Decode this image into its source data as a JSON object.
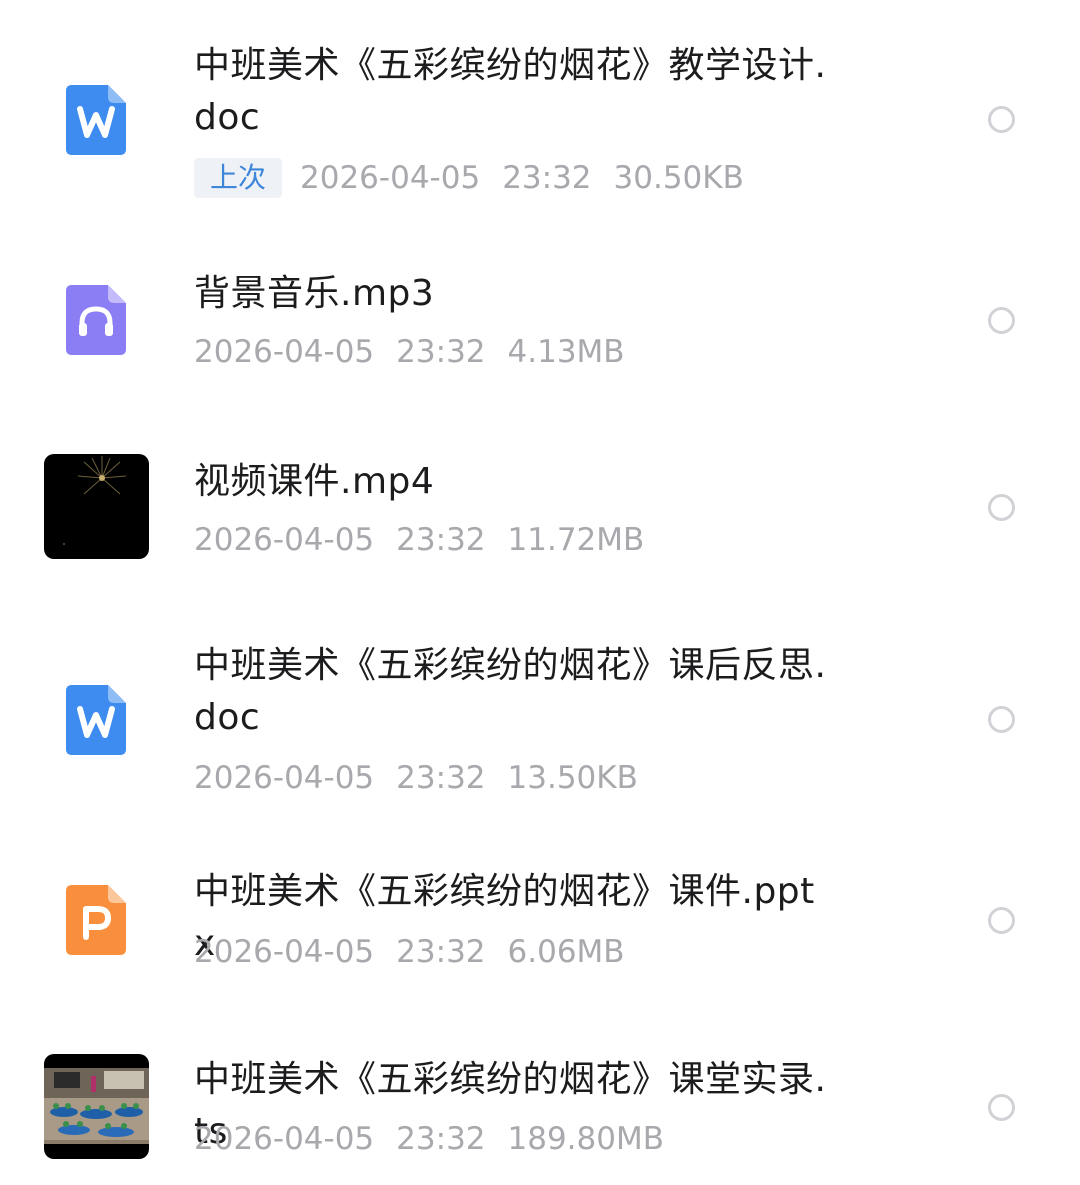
{
  "files": [
    {
      "name": "中班美术《五彩缤纷的烟花》教学设计.doc",
      "tag": "上次",
      "date": "2026-04-05",
      "time": "23:32",
      "size": "30.50KB",
      "icon": "word-doc-icon",
      "color": "#3f8cf0"
    },
    {
      "name": "背景音乐.mp3",
      "date": "2026-04-05",
      "time": "23:32",
      "size": "4.13MB",
      "icon": "audio-file-icon",
      "color": "#8b7ef5"
    },
    {
      "name": "视频课件.mp4",
      "date": "2026-04-05",
      "time": "23:32",
      "size": "11.72MB",
      "icon": "video-thumbnail",
      "color": "#000000"
    },
    {
      "name": "中班美术《五彩缤纷的烟花》课后反思.doc",
      "date": "2026-04-05",
      "time": "23:32",
      "size": "13.50KB",
      "icon": "word-doc-icon",
      "color": "#3f8cf0"
    },
    {
      "name": "中班美术《五彩缤纷的烟花》课件.pptx",
      "date": "2026-04-05",
      "time": "23:32",
      "size": "6.06MB",
      "icon": "ppt-file-icon",
      "color": "#f98f3c"
    },
    {
      "name": "中班美术《五彩缤纷的烟花》课堂实录.ts",
      "date": "2026-04-05",
      "time": "23:32",
      "size": "189.80MB",
      "icon": "video-thumbnail",
      "color": "#000000"
    }
  ]
}
